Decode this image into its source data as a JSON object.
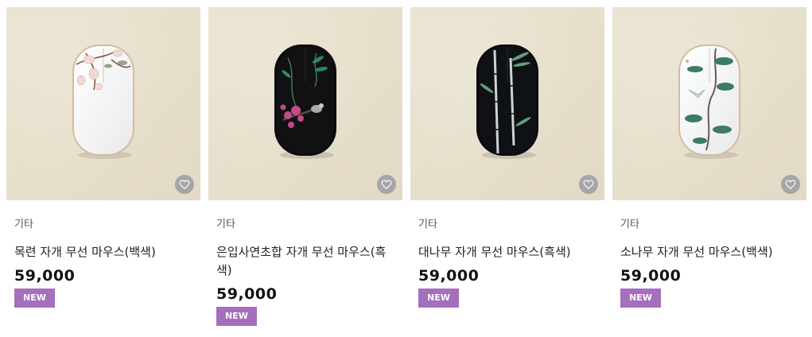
{
  "products": [
    {
      "category": "기타",
      "name": "목련 자개 무선 마우스(백색)",
      "price": "59,000",
      "badge": "NEW",
      "variant": "white",
      "motif": "magnolia",
      "image_bg": "#e8e1cd"
    },
    {
      "category": "기타",
      "name": "은입사연초합 자개 무선 마우스(흑색)",
      "price": "59,000",
      "badge": "NEW",
      "variant": "black",
      "motif": "plum-blossom-bird",
      "image_bg": "#e8e1cd"
    },
    {
      "category": "기타",
      "name": "대나무 자개 무선 마우스(흑색)",
      "price": "59,000",
      "badge": "NEW",
      "variant": "black",
      "motif": "bamboo",
      "image_bg": "#e8e1cd"
    },
    {
      "category": "기타",
      "name": "소나무 자개 무선 마우스(백색)",
      "price": "59,000",
      "badge": "NEW",
      "variant": "white",
      "motif": "pine-crane",
      "image_bg": "#e8e1cd"
    }
  ],
  "icons": {
    "wishlist": "heart-icon"
  },
  "colors": {
    "badge": "#a56fbd",
    "wish_button": "#a6a6a6"
  }
}
